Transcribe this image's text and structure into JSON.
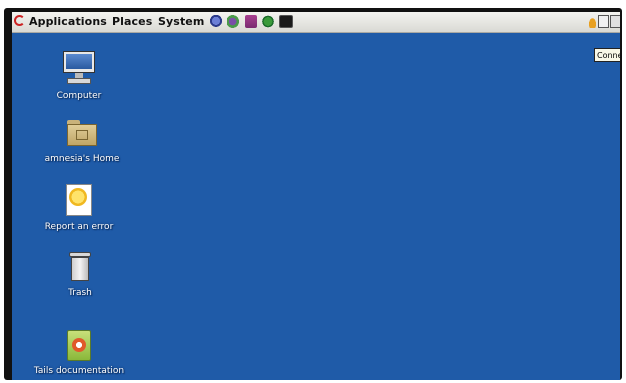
{
  "panel": {
    "menus": {
      "applications": "Applications",
      "places": "Places",
      "system": "System"
    },
    "launchers": [
      "tor-browser-icon",
      "pidgin-icon",
      "keepassx-icon",
      "claws-mail-icon",
      "terminal-icon"
    ],
    "tray": [
      "vidalia-onion-icon",
      "clipboard-icon",
      "keyboard-icon"
    ],
    "tooltip": "Conne"
  },
  "desktop": {
    "background": "#1f5ba8",
    "icons": [
      {
        "label": "Computer",
        "icon": "computer-icon"
      },
      {
        "label": "amnesia's Home",
        "icon": "home-folder-icon"
      },
      {
        "label": "Report an error",
        "icon": "report-error-icon"
      },
      {
        "label": "Trash",
        "icon": "trash-icon"
      },
      {
        "label": "Tails documentation",
        "icon": "tails-documentation-icon"
      }
    ]
  }
}
